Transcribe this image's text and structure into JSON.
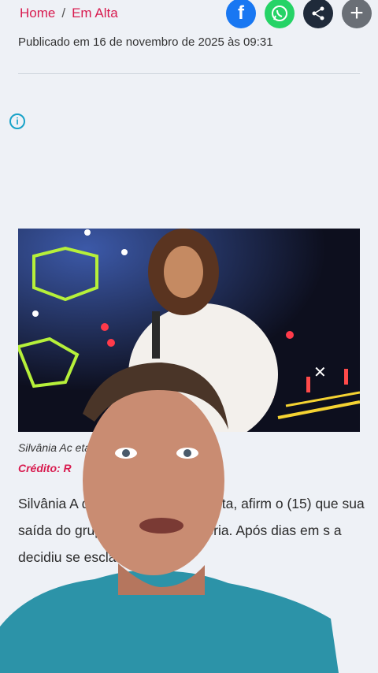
{
  "breadcrumb": {
    "home": "Home",
    "separator": "/",
    "section": "Em Alta"
  },
  "share": {
    "facebook_icon": "f",
    "whatsapp_icon": "whatsapp-icon",
    "share_icon": "share-icon",
    "more_icon": "+"
  },
  "article": {
    "published": "Publicado em 16 de novembro de 2025 às 09:31",
    "image_caption": "Silvânia Ac                                        eta após 23 anos",
    "credit": "Crédito: R",
    "paragraph": "Silvânia A              da banda Calcinha Preta, afirm              o (15) que sua saída do grupo nã              vontade própria. Após dias em s              a decidiu se                                esclarecer"
  },
  "colors": {
    "accent": "#d81b4f",
    "facebook": "#1877f2",
    "whatsapp": "#25d366"
  }
}
